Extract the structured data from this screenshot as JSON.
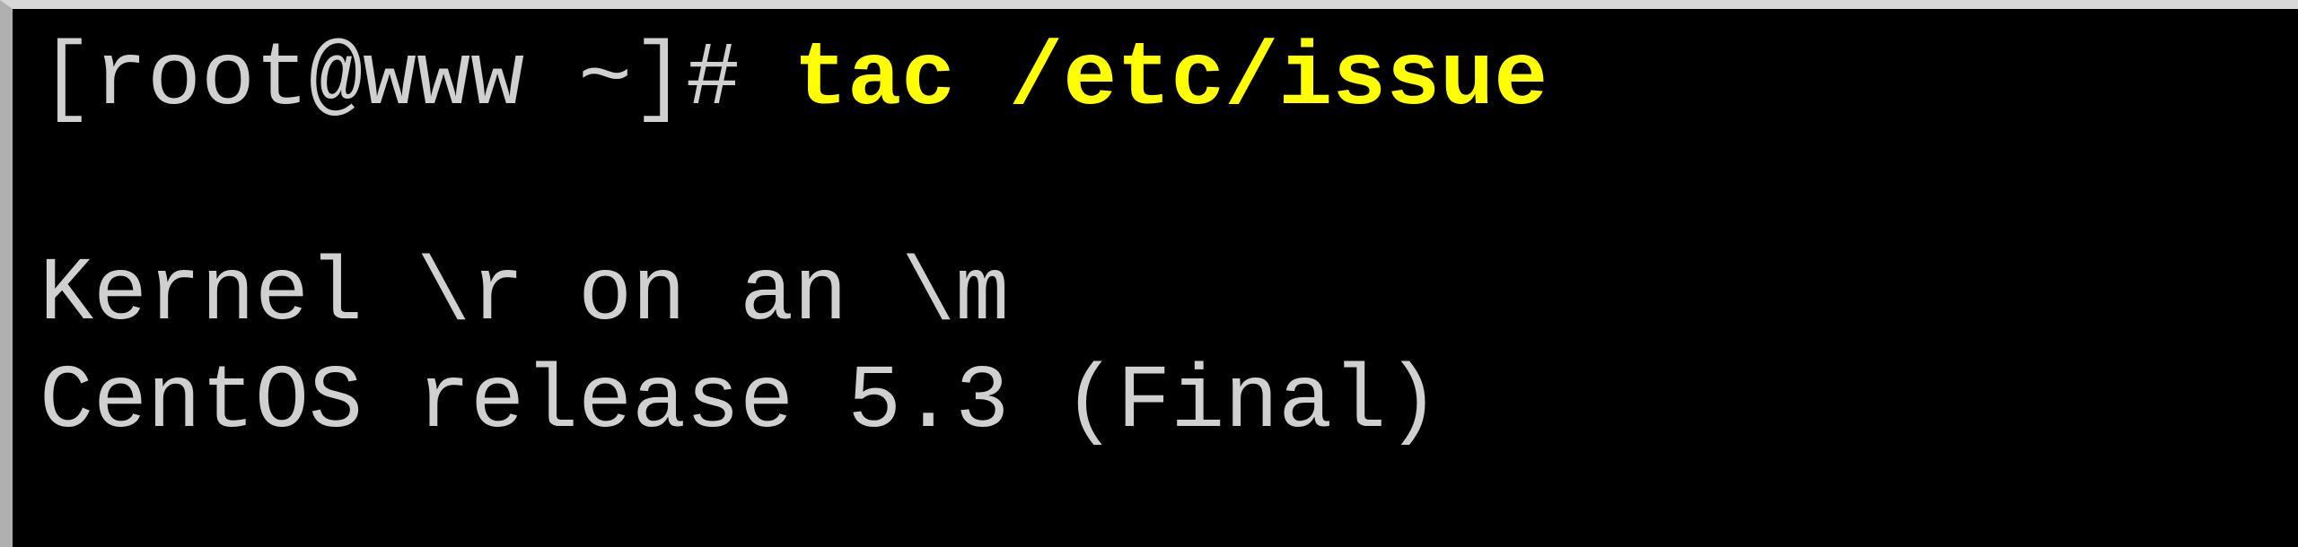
{
  "terminal": {
    "prompt": "[root@www ~]# ",
    "command": "tac /etc/issue",
    "output_lines": [
      "",
      "Kernel \\r on an \\m",
      "CentOS release 5.3 (Final)"
    ]
  }
}
